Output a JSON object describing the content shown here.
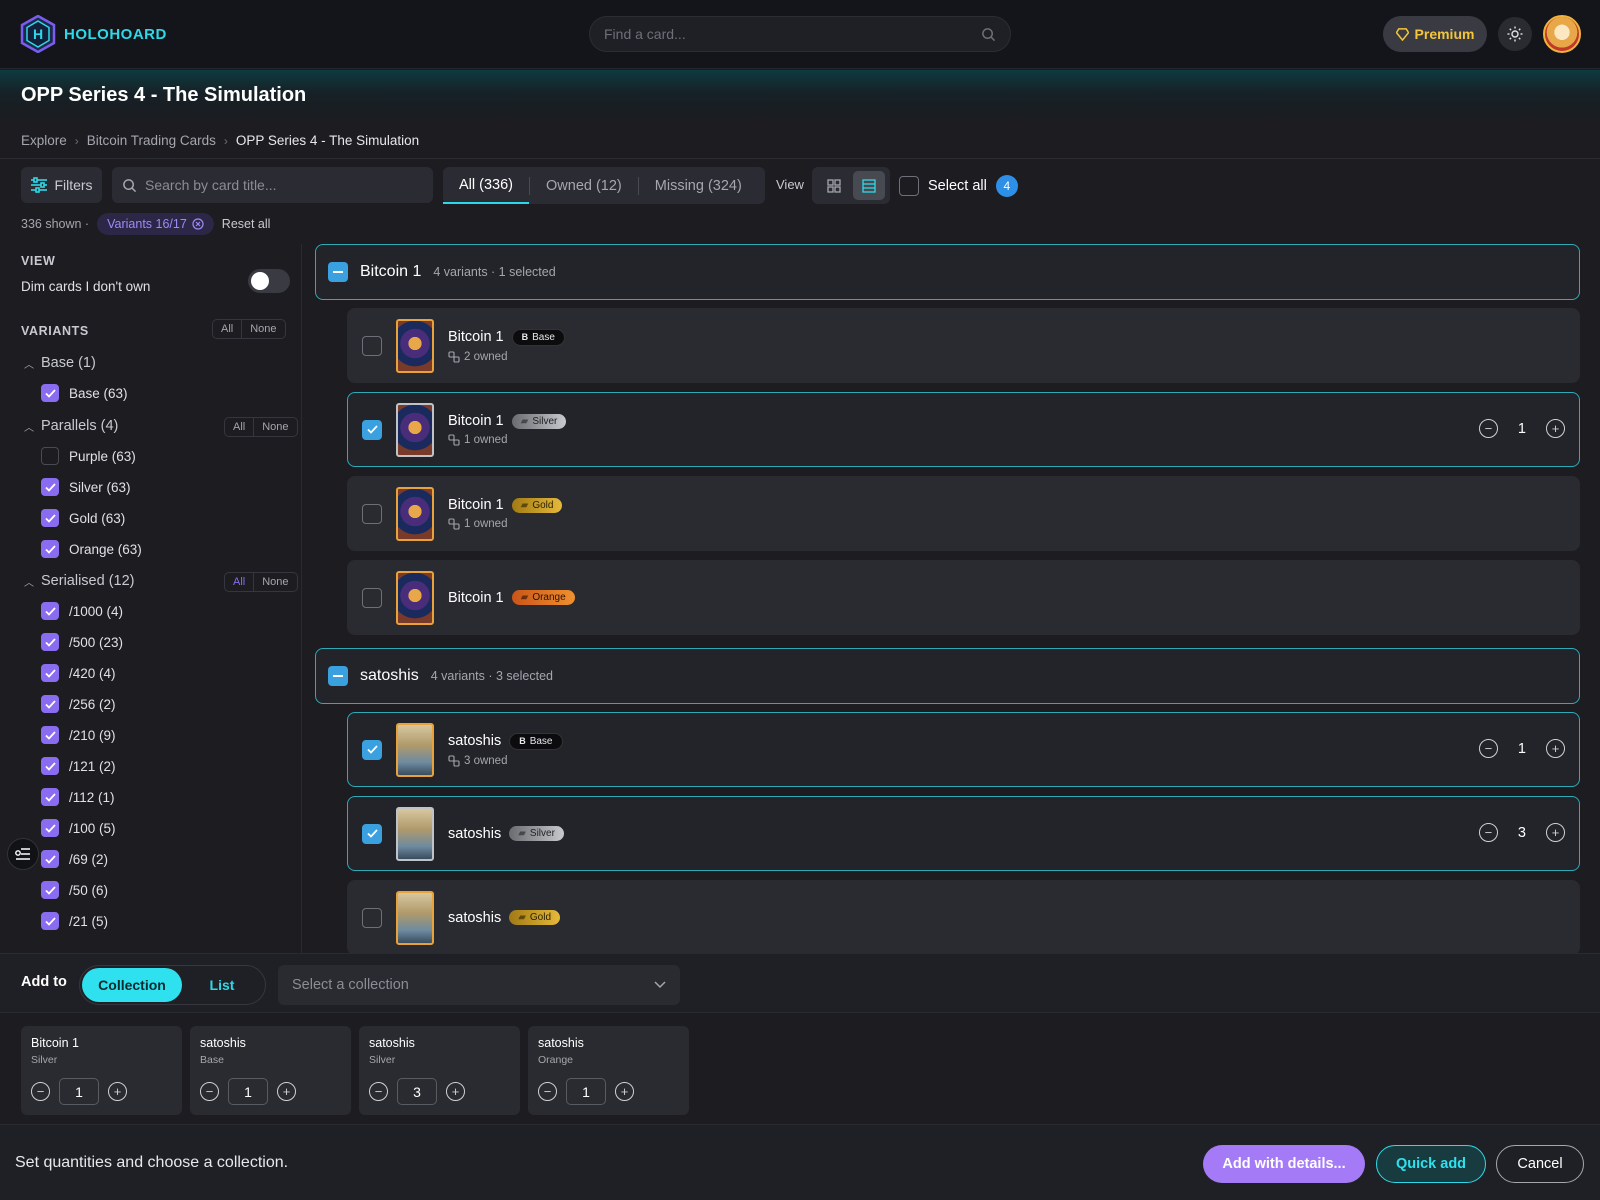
{
  "app": {
    "name": "HOLOHOARD"
  },
  "header": {
    "search_placeholder": "Find a card...",
    "premium_label": "Premium"
  },
  "page": {
    "title": "OPP Series 4 - The Simulation"
  },
  "breadcrumb": [
    "Explore",
    "Bitcoin Trading Cards",
    "OPP Series 4 - The Simulation"
  ],
  "toolbar": {
    "filters_label": "Filters",
    "search_placeholder": "Search by card title...",
    "tabs": [
      "All (336)",
      "Owned (12)",
      "Missing (324)"
    ],
    "active_tab": "All (336)",
    "view_label": "View",
    "select_all_label": "Select all",
    "selected_count": "4"
  },
  "status": {
    "shown": "336 shown ·",
    "variants_chip": "Variants 16/17",
    "reset_label": "Reset all"
  },
  "sidebar": {
    "view_heading": "VIEW",
    "dim_label": "Dim cards I don't own",
    "dim_enabled": false,
    "variants_heading": "VARIANTS",
    "all_label": "All",
    "none_label": "None",
    "groups": [
      {
        "label": "Base (1)",
        "options": [
          {
            "label": "Base (63)",
            "checked": true
          }
        ]
      },
      {
        "label": "Parallels (4)",
        "options": [
          {
            "label": "Purple (63)",
            "checked": false
          },
          {
            "label": "Silver (63)",
            "checked": true
          },
          {
            "label": "Gold (63)",
            "checked": true
          },
          {
            "label": "Orange (63)",
            "checked": true
          }
        ]
      },
      {
        "label": "Serialised (12)",
        "options": [
          {
            "label": "/1000 (4)",
            "checked": true
          },
          {
            "label": "/500 (23)",
            "checked": true
          },
          {
            "label": "/420 (4)",
            "checked": true
          },
          {
            "label": "/256 (2)",
            "checked": true
          },
          {
            "label": "/210 (9)",
            "checked": true
          },
          {
            "label": "/121 (2)",
            "checked": true
          },
          {
            "label": "/112 (1)",
            "checked": true
          },
          {
            "label": "/100 (5)",
            "checked": true
          },
          {
            "label": "/69 (2)",
            "checked": true
          },
          {
            "label": "/50 (6)",
            "checked": true
          },
          {
            "label": "/21 (5)",
            "checked": true
          }
        ]
      }
    ]
  },
  "groups": [
    {
      "name": "Bitcoin 1",
      "meta": "4 variants · 1 selected",
      "cards": [
        {
          "name": "Bitcoin 1",
          "variant": "Base",
          "owned": "2 owned",
          "selected": false
        },
        {
          "name": "Bitcoin 1",
          "variant": "Silver",
          "owned": "1 owned",
          "selected": true,
          "qty": "1"
        },
        {
          "name": "Bitcoin 1",
          "variant": "Gold",
          "owned": "1 owned",
          "selected": false
        },
        {
          "name": "Bitcoin 1",
          "variant": "Orange",
          "owned": "",
          "selected": false
        }
      ]
    },
    {
      "name": "satoshis",
      "meta": "4 variants · 3 selected",
      "cards": [
        {
          "name": "satoshis",
          "variant": "Base",
          "owned": "3 owned",
          "selected": true,
          "qty": "1"
        },
        {
          "name": "satoshis",
          "variant": "Silver",
          "owned": "",
          "selected": true,
          "qty": "3"
        },
        {
          "name": "satoshis",
          "variant": "Gold",
          "owned": "",
          "selected": false
        }
      ]
    }
  ],
  "add_to": {
    "label": "Add to",
    "options": [
      "Collection",
      "List"
    ],
    "active": "Collection",
    "select_placeholder": "Select a collection"
  },
  "pending": [
    {
      "name": "Bitcoin 1",
      "variant": "Silver",
      "qty": "1"
    },
    {
      "name": "satoshis",
      "variant": "Base",
      "qty": "1"
    },
    {
      "name": "satoshis",
      "variant": "Silver",
      "qty": "3"
    },
    {
      "name": "satoshis",
      "variant": "Orange",
      "qty": "1"
    }
  ],
  "footer": {
    "message": "Set quantities and choose a collection.",
    "details_label": "Add with details...",
    "quick_label": "Quick add",
    "cancel_label": "Cancel"
  },
  "colors": {
    "accent": "#2fd8e8",
    "purple": "#a57af6",
    "select_blue": "#3aa0e0"
  }
}
